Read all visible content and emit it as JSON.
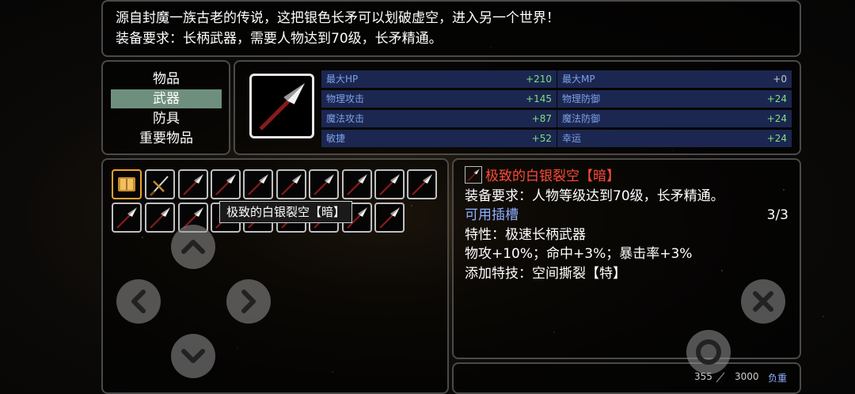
{
  "description": {
    "line1": "源自封魔一族古老的传说，这把银色长矛可以划破虚空，进入另一个世界！",
    "line2": "装备要求：长柄武器，需要人物达到70级，长矛精通。"
  },
  "categories": [
    {
      "label": "物品"
    },
    {
      "label": "武器"
    },
    {
      "label": "防具"
    },
    {
      "label": "重要物品"
    }
  ],
  "stats": [
    {
      "label": "最大HP",
      "value": "+210"
    },
    {
      "label": "最大MP",
      "value": "+0"
    },
    {
      "label": "物理攻击",
      "value": "+145"
    },
    {
      "label": "物理防御",
      "value": "+24"
    },
    {
      "label": "魔法攻击",
      "value": "+87"
    },
    {
      "label": "魔法防御",
      "value": "+24"
    },
    {
      "label": "敏捷",
      "value": "+52"
    },
    {
      "label": "幸运",
      "value": "+24"
    }
  ],
  "tooltip": "极致的白银裂空【暗】",
  "info": {
    "name": "极致的白银裂空【暗】",
    "requirement": "装备要求：人物等级达到70级，长矛精通。",
    "slots_label": "可用插槽",
    "slots_value": "3/3",
    "trait": "特性：极速长柄武器",
    "bonus": "物攻+10%；命中+3%；暴击率+3%",
    "skill": "添加特技：空间撕裂【特】"
  },
  "weight": {
    "current": "355",
    "max": "3000",
    "label": "负重"
  },
  "colors": {
    "item_name": "#ff4a3a",
    "stat_label": "#7fa0e6",
    "stat_value": "#7fe07f",
    "selected_category": "#6f8f7e"
  },
  "icons": {
    "slot_0": "spellbook-icon",
    "slot_1": "sword-icon",
    "default_slot": "spear-icon"
  }
}
